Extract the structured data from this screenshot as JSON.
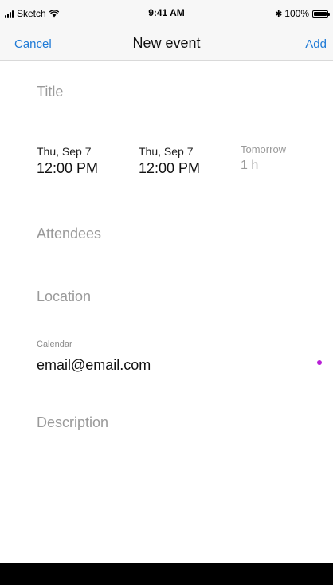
{
  "status_bar": {
    "carrier": "Sketch",
    "time": "9:41 AM",
    "battery_text": "100%",
    "bluetooth_glyph": "✱"
  },
  "nav": {
    "cancel_label": "Cancel",
    "title": "New event",
    "add_label": "Add"
  },
  "form": {
    "title_placeholder": "Title",
    "start": {
      "date": "Thu, Sep 7",
      "time": "12:00 PM"
    },
    "end": {
      "date": "Thu, Sep 7",
      "time": "12:00 PM"
    },
    "duration": {
      "day": "Tomorrow",
      "length": "1 h"
    },
    "attendees_placeholder": "Attendees",
    "location_placeholder": "Location",
    "calendar": {
      "label": "Calendar",
      "value": "email@email.com",
      "dot_color": "#b81fd6"
    },
    "description_placeholder": "Description"
  },
  "colors": {
    "accent": "#1f7ad6"
  }
}
